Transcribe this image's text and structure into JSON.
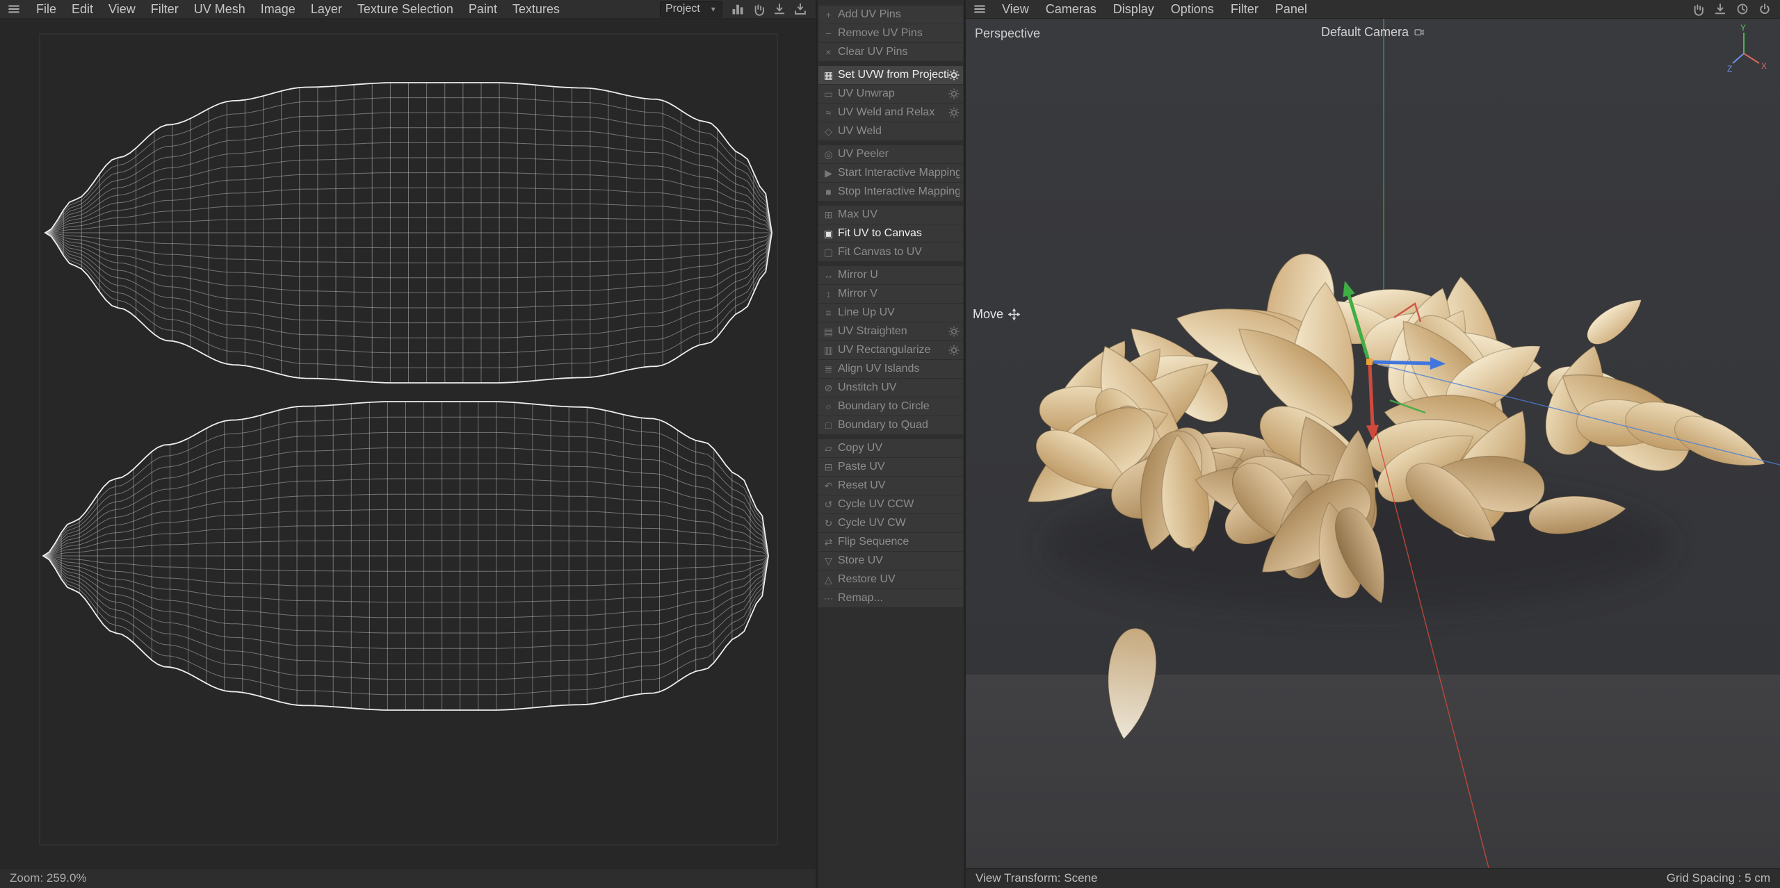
{
  "menubar": {
    "left_items": [
      "File",
      "Edit",
      "View",
      "Filter",
      "UV Mesh",
      "Image",
      "Layer",
      "Texture Selection",
      "Paint",
      "Textures"
    ],
    "project_dropdown": "Project",
    "dropdown_chevron": "▾",
    "toolbar_icons": [
      "histogram-icon",
      "pan-hand-icon",
      "download-icon",
      "import-download-icon"
    ],
    "window_icons": [
      "pan-hand-icon",
      "download-icon",
      "history-clock-icon",
      "power-icon"
    ]
  },
  "viewport_menubar": {
    "items": [
      "View",
      "Cameras",
      "Display",
      "Options",
      "Filter",
      "Panel"
    ]
  },
  "uv_commands": {
    "groups": [
      {
        "items": [
          {
            "label": "Add UV Pins",
            "icon": "+",
            "enabled": false
          },
          {
            "label": "Remove UV Pins",
            "icon": "−",
            "enabled": false
          },
          {
            "label": "Clear UV Pins",
            "icon": "×",
            "enabled": false
          }
        ]
      },
      {
        "items": [
          {
            "label": "Set UVW from Projection",
            "icon": "▦",
            "enabled": true,
            "highlight": true,
            "gear": true
          },
          {
            "label": "UV Unwrap",
            "icon": "▭",
            "enabled": false,
            "gear": true
          },
          {
            "label": "UV Weld and Relax",
            "icon": "≈",
            "enabled": false,
            "gear": true
          },
          {
            "label": "UV Weld",
            "icon": "◇",
            "enabled": false
          }
        ]
      },
      {
        "items": [
          {
            "label": "UV Peeler",
            "icon": "◎",
            "enabled": false
          },
          {
            "label": "Start Interactive Mapping",
            "icon": "▶",
            "enabled": false
          },
          {
            "label": "Stop Interactive Mapping",
            "icon": "■",
            "enabled": false
          }
        ]
      },
      {
        "items": [
          {
            "label": "Max UV",
            "icon": "⊞",
            "enabled": false
          },
          {
            "label": "Fit UV to Canvas",
            "icon": "▣",
            "enabled": true
          },
          {
            "label": "Fit Canvas to UV",
            "icon": "▢",
            "enabled": false
          }
        ]
      },
      {
        "items": [
          {
            "label": "Mirror U",
            "icon": "↔",
            "enabled": false
          },
          {
            "label": "Mirror V",
            "icon": "↕",
            "enabled": false
          },
          {
            "label": "Line Up UV",
            "icon": "≡",
            "enabled": false
          },
          {
            "label": "UV Straighten",
            "icon": "▤",
            "enabled": false,
            "gear": true
          },
          {
            "label": "UV Rectangularize",
            "icon": "▥",
            "enabled": false,
            "gear": true
          },
          {
            "label": "Align UV Islands",
            "icon": "≣",
            "enabled": false
          },
          {
            "label": "Unstitch UV",
            "icon": "⊘",
            "enabled": false
          },
          {
            "label": "Boundary to Circle",
            "icon": "○",
            "enabled": false
          },
          {
            "label": "Boundary to Quad",
            "icon": "□",
            "enabled": false
          }
        ]
      },
      {
        "items": [
          {
            "label": "Copy UV",
            "icon": "▱",
            "enabled": false
          },
          {
            "label": "Paste UV",
            "icon": "⊟",
            "enabled": false
          },
          {
            "label": "Reset UV",
            "icon": "↶",
            "enabled": false
          },
          {
            "label": "Cycle UV CCW",
            "icon": "↺",
            "enabled": false
          },
          {
            "label": "Cycle UV CW",
            "icon": "↻",
            "enabled": false
          },
          {
            "label": "Flip Sequence",
            "icon": "⇄",
            "enabled": false
          },
          {
            "label": "Store UV",
            "icon": "▽",
            "enabled": false
          },
          {
            "label": "Restore UV",
            "icon": "△",
            "enabled": false
          },
          {
            "label": "Remap...",
            "icon": "⋯",
            "enabled": false
          }
        ]
      }
    ]
  },
  "viewport": {
    "view_label": "Perspective",
    "camera_label": "Default Camera",
    "tool_label": "Move",
    "footer_left": "View Transform: Scene",
    "footer_right": "Grid Spacing : 5 cm",
    "axis_labels": {
      "x": "X",
      "y": "Y",
      "z": "Z"
    }
  },
  "statusbar": {
    "zoom_label": "Zoom: 259.0%"
  },
  "colors": {
    "axis_x": "#cf4a3c",
    "axis_y": "#3fae45",
    "axis_z": "#3f76e0",
    "gizmo_center": "#e9a43c",
    "seed_light": "#f3e7ca",
    "seed_dark": "#91734a",
    "wire": "#ededed"
  }
}
